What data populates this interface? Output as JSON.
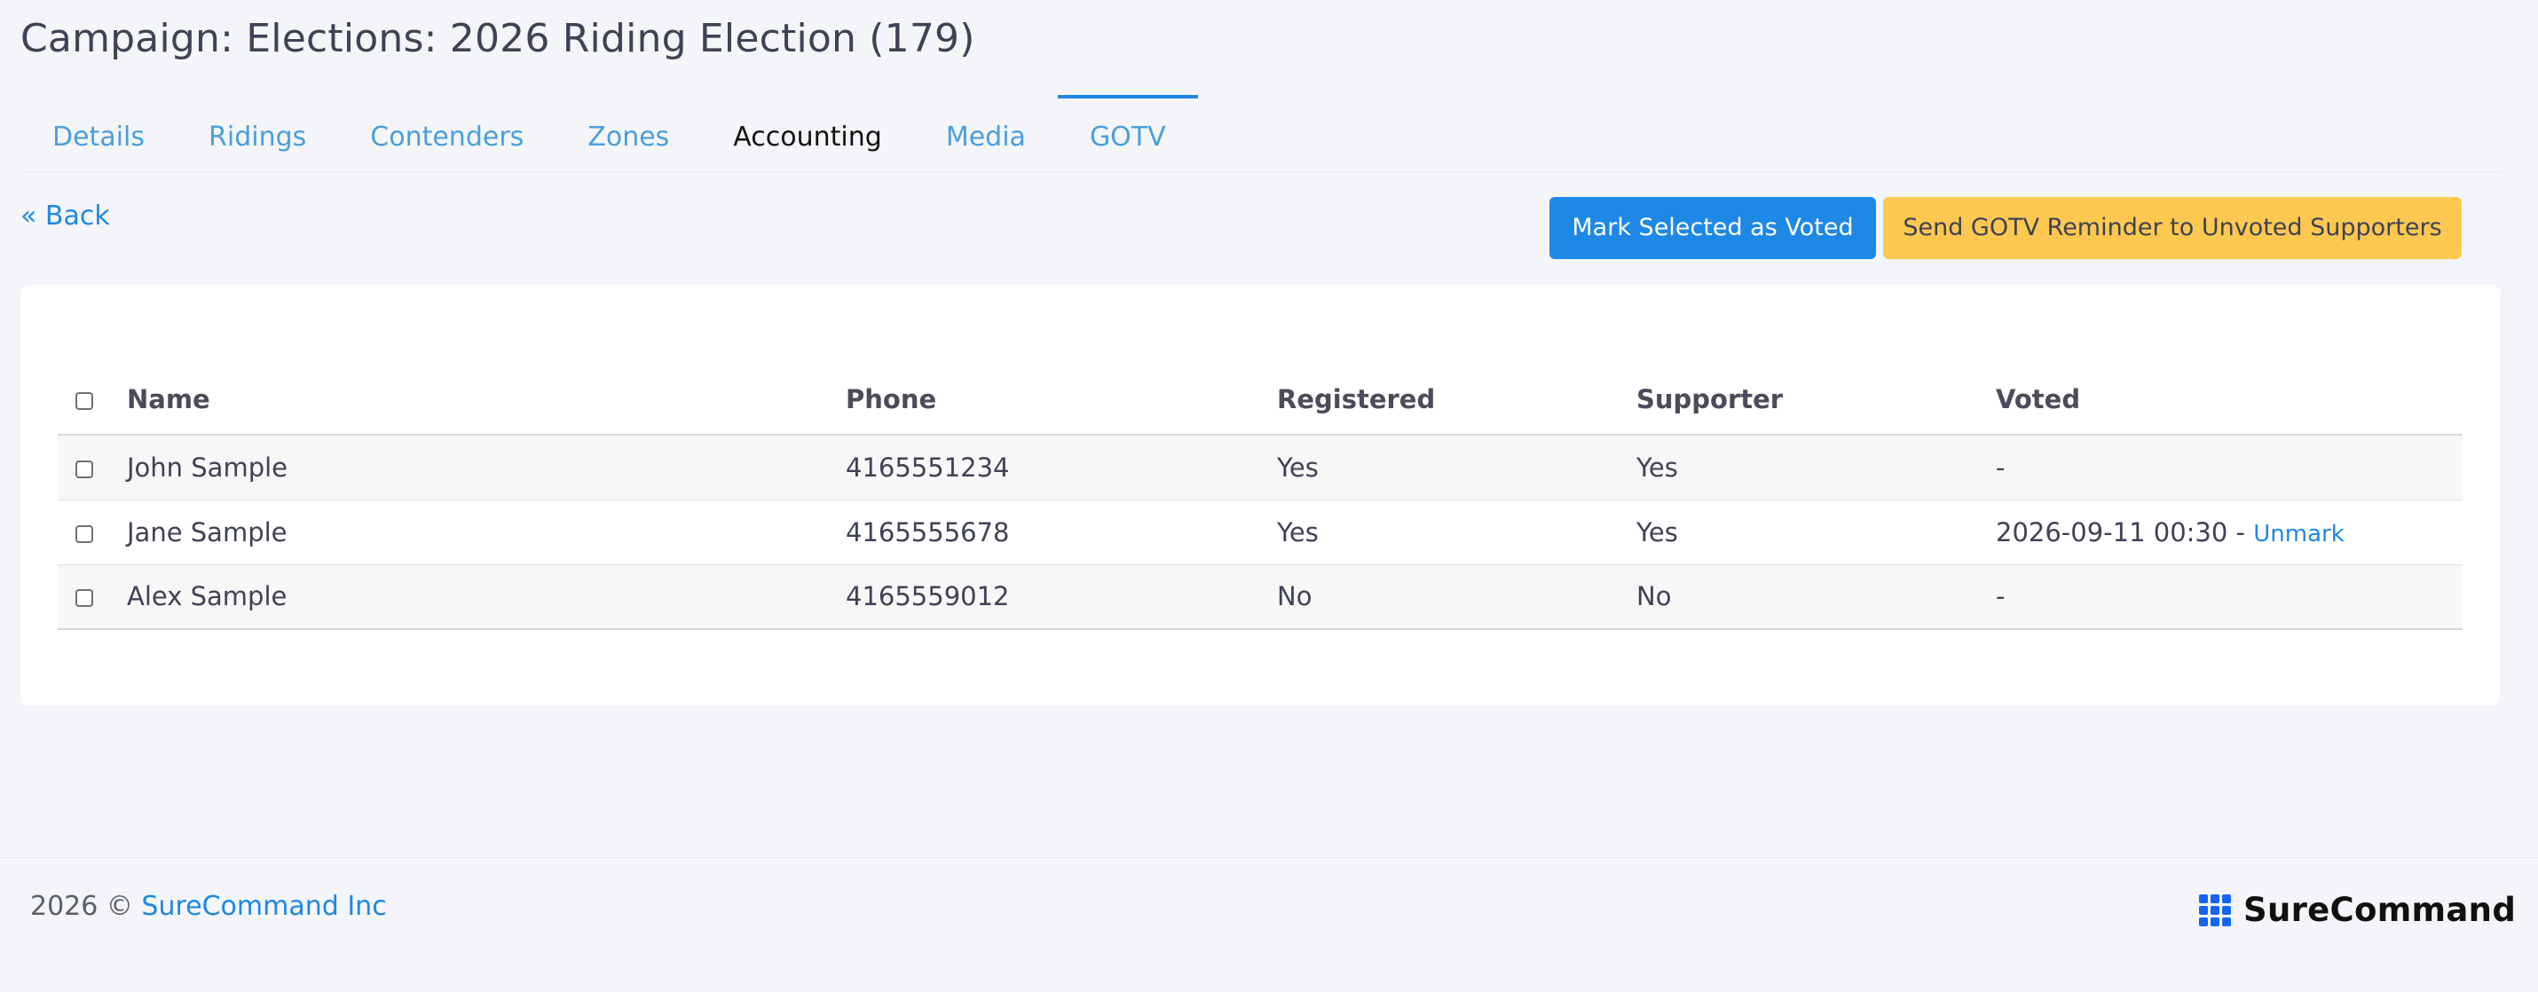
{
  "page": {
    "title": "Campaign: Elections: 2026 Riding Election (179)"
  },
  "tabs": [
    {
      "label": "Details"
    },
    {
      "label": "Ridings"
    },
    {
      "label": "Contenders"
    },
    {
      "label": "Zones"
    },
    {
      "label": "Accounting"
    },
    {
      "label": "Media"
    },
    {
      "label": "GOTV"
    }
  ],
  "actions": {
    "back_label": "« Back",
    "mark_voted_label": "Mark Selected as Voted",
    "send_reminder_label": "Send GOTV Reminder to Unvoted Supporters"
  },
  "table": {
    "headers": {
      "name": "Name",
      "phone": "Phone",
      "registered": "Registered",
      "supporter": "Supporter",
      "voted": "Voted"
    },
    "rows": [
      {
        "name": "John Sample",
        "phone": "4165551234",
        "registered": "Yes",
        "supporter": "Yes",
        "voted": "-",
        "unmark": ""
      },
      {
        "name": "Jane Sample",
        "phone": "4165555678",
        "registered": "Yes",
        "supporter": "Yes",
        "voted": "2026-09-11 00:30 - ",
        "unmark": "Unmark"
      },
      {
        "name": "Alex Sample",
        "phone": "4165559012",
        "registered": "No",
        "supporter": "No",
        "voted": "-",
        "unmark": ""
      }
    ]
  },
  "footer": {
    "copyright": "2026 © ",
    "company_link": "SureCommand Inc",
    "brand_name": "SureCommand",
    "brand_icon": "grid-logo-icon",
    "brand_color": "#1565f5"
  },
  "colors": {
    "primary": "#1e88e5",
    "warning": "#fcc850",
    "link": "#4a9fdc"
  }
}
